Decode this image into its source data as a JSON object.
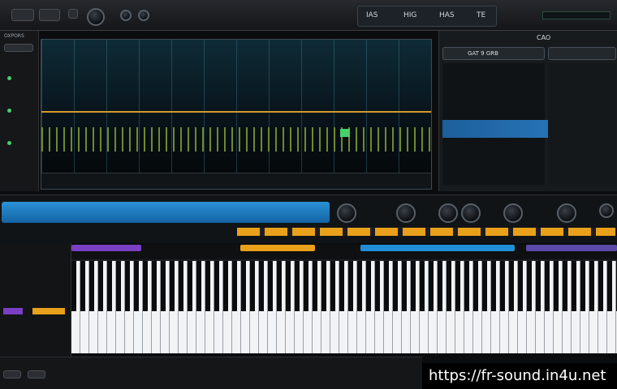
{
  "window": {
    "top_badges": [
      "IAS",
      "HIG",
      "HAS",
      "TE"
    ]
  },
  "left_panel": {
    "header": "OXPORS",
    "lane_labels": [
      "",
      "",
      "",
      ""
    ]
  },
  "display": {
    "accent_line_color": "#d59a2a"
  },
  "mixer_panel": {
    "header_label": "CAO",
    "channel_title": "GAT 9 GRB",
    "info_rows": [
      "",
      "",
      "",
      ""
    ]
  },
  "watermark": "https://fr-sound.in4u.net",
  "colors": {
    "accent_blue": "#1f8fd6",
    "accent_orange": "#e9a01b",
    "accent_purple": "#7a3fc2",
    "accent_green": "#45d06a"
  }
}
